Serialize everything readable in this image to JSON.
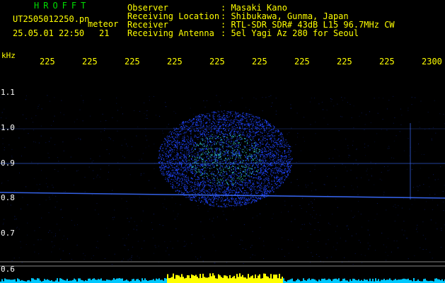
{
  "header": {
    "brand": "HROFFT",
    "filename": "UT2505012250.pn",
    "tag": "meteor",
    "datetime": "25.05.01 22:50",
    "num": "21",
    "labels": [
      "Observer",
      "Receiving Location",
      "Receiver",
      "Receiving Antenna"
    ],
    "values": [
      ": Masaki Kano",
      ": Shibukawa, Gunma, Japan",
      ": RTL-SDR SDR# 43dB L15 96.7MHz CW",
      ": 5el Yagi Az 280 for Seoul"
    ]
  },
  "axes": {
    "y_unit": "kHz",
    "x_ticks": [
      "225",
      "225",
      "225",
      "225",
      "225",
      "225",
      "225",
      "225",
      "225",
      "2300"
    ],
    "y_ticks": [
      "1.1",
      "1.0",
      "0.9",
      "0.8",
      "0.7",
      "0.6"
    ]
  },
  "colors": {
    "background": "#000000",
    "header_text": "#ffff00",
    "brand": "#00dd00",
    "echo_blue": "#1f45ff",
    "echo_core": "#36d2c0",
    "carrier": "#3a6cff",
    "spectrum": "#00c8ff",
    "spectrum_peak": "#ffff00"
  }
}
